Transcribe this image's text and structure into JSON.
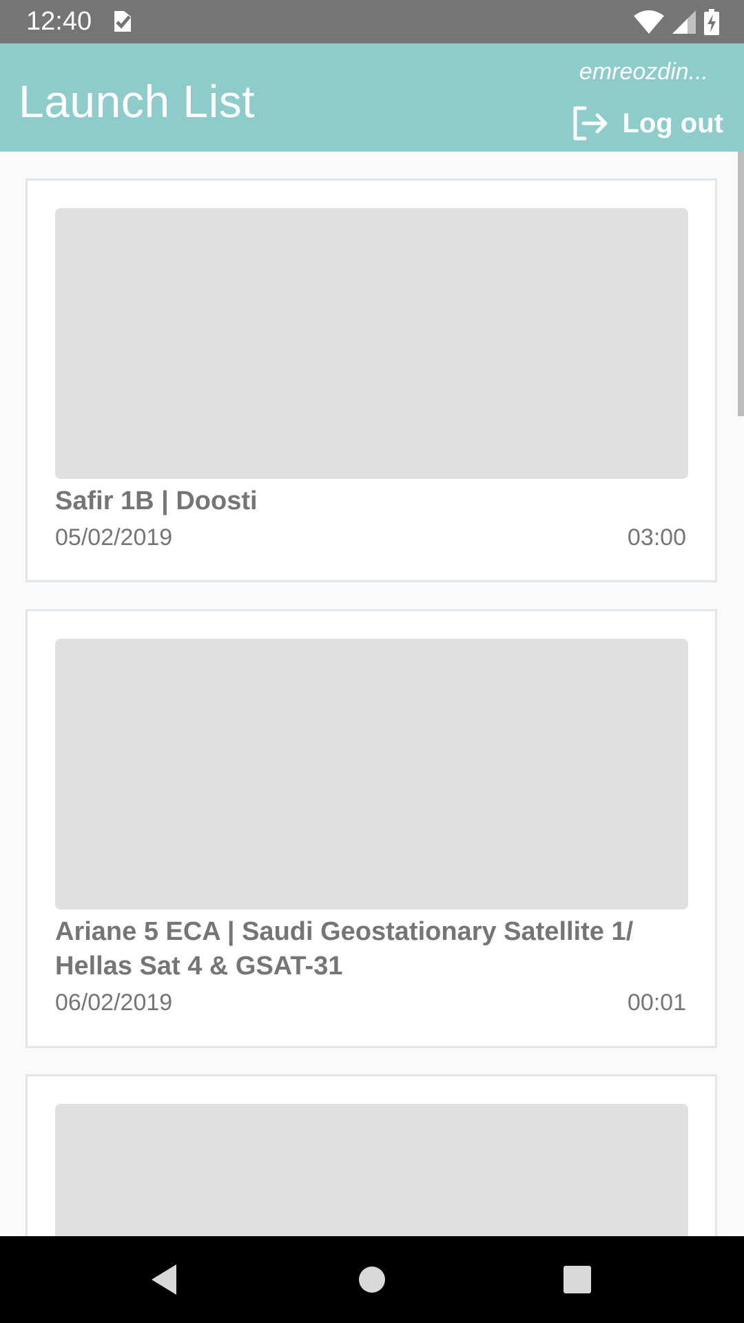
{
  "status_bar": {
    "time": "12:40",
    "icons": [
      "notification-check-icon",
      "wifi-icon",
      "cellular-signal-icon",
      "battery-charging-icon"
    ]
  },
  "app_bar": {
    "title": "Launch List",
    "username": "emreozdin...",
    "logout_label": "Log out",
    "background_color": "#8ecccb"
  },
  "launches": [
    {
      "title": "Safir 1B | Doosti",
      "date": "05/02/2019",
      "time": "03:00"
    },
    {
      "title": "Ariane 5 ECA | Saudi Geostationary Satellite 1/ Hellas Sat 4 & GSAT-31",
      "date": "06/02/2019",
      "time": "00:01"
    }
  ],
  "nav_bar": {
    "buttons": [
      "back-icon",
      "home-icon",
      "recents-icon"
    ]
  }
}
